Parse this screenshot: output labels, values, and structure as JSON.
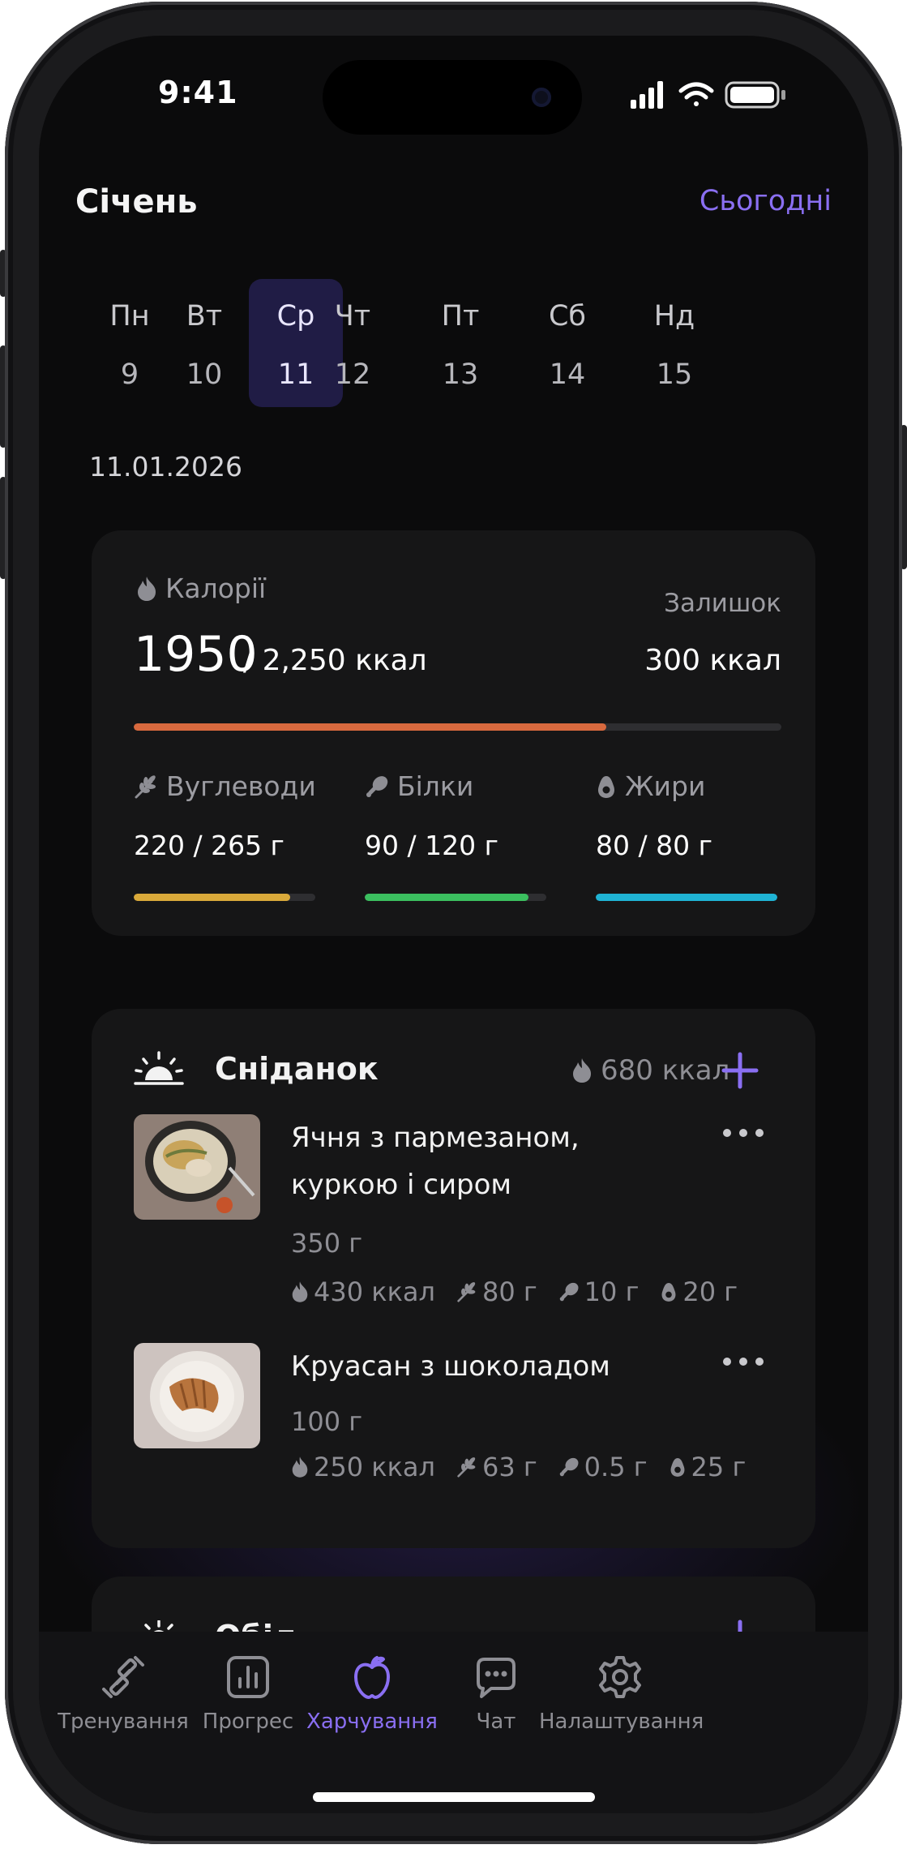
{
  "status_bar": {
    "time": "9:41"
  },
  "header": {
    "month": "Січень",
    "today_link": "Сьогодні"
  },
  "week": [
    {
      "day": "Пн",
      "date": "9",
      "selected": false
    },
    {
      "day": "Вт",
      "date": "10",
      "selected": false
    },
    {
      "day": "Ср",
      "date": "11",
      "selected": true
    },
    {
      "day": "Чт",
      "date": "12",
      "selected": false
    },
    {
      "day": "Пт",
      "date": "13",
      "selected": false
    },
    {
      "day": "Сб",
      "date": "14",
      "selected": false
    },
    {
      "day": "Нд",
      "date": "15",
      "selected": false
    }
  ],
  "selected_date": "11.01.2026",
  "calories": {
    "title": "Калорії",
    "consumed": "1950",
    "total_text": "/ 2,250 ккал",
    "remaining_label": "Залишок",
    "remaining_value": "300 ккал",
    "progress": 0.73,
    "color": "#d8693e"
  },
  "macros": [
    {
      "name": "Вуглеводи",
      "icon": "wheat-icon",
      "value": "220 / 265 г",
      "progress": 0.86,
      "color": "#d9a93a"
    },
    {
      "name": "Білки",
      "icon": "drumstick-icon",
      "value": "90 / 120 г",
      "progress": 0.9,
      "color": "#3bbf5f"
    },
    {
      "name": "Жири",
      "icon": "avocado-icon",
      "value": "80 / 80 г",
      "progress": 1.0,
      "color": "#1fb3d4"
    }
  ],
  "meals": [
    {
      "name": "Сніданок",
      "icon": "sunrise-icon",
      "kcal": "680 ккал",
      "items": [
        {
          "name": "Ячня з пармезаном, куркою і сиром",
          "weight": "350 г",
          "kcal": "430 ккал",
          "carbs": "80 г",
          "protein": "10 г",
          "fat": "20 г",
          "image": "eggs-dish-photo"
        },
        {
          "name": "Круасан з шоколадом",
          "weight": "100 г",
          "kcal": "250 ккал",
          "carbs": "63 г",
          "protein": "0.5 г",
          "fat": "25 г",
          "image": "croissant-photo"
        }
      ]
    },
    {
      "name": "Обід",
      "icon": "sun-icon"
    }
  ],
  "tabs": [
    {
      "label": "Тренування",
      "icon": "dumbbell-icon",
      "active": false
    },
    {
      "label": "Прогрес",
      "icon": "chart-icon",
      "active": false
    },
    {
      "label": "Харчування",
      "icon": "apple-icon",
      "active": true
    },
    {
      "label": "Чат",
      "icon": "chat-icon",
      "active": false
    },
    {
      "label": "Налаштування",
      "icon": "gear-icon",
      "active": false
    }
  ],
  "colors": {
    "accent": "#8a6ff2",
    "background": "#0b0b0c",
    "card": "#161617"
  }
}
